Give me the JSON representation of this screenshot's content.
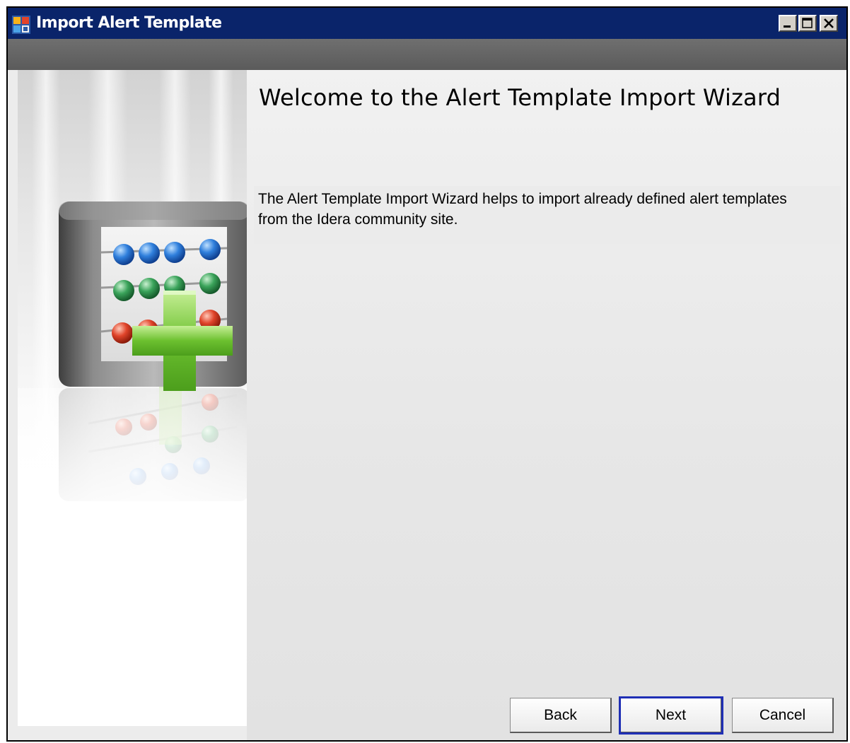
{
  "window": {
    "title": "Import Alert Template"
  },
  "wizard": {
    "heading": "Welcome to the Alert Template Import Wizard",
    "description": "The Alert Template Import Wizard helps to import already defined alert templates from the Idera community site."
  },
  "buttons": {
    "back": "Back",
    "next": "Next",
    "cancel": "Cancel"
  },
  "icons": {
    "app": "app-icon",
    "minimize": "minimize-icon",
    "maximize": "maximize-icon",
    "close": "close-icon",
    "illustration": "abacus-plus-icon"
  },
  "colors": {
    "titlebar": "#0a246a",
    "focus": "#1f2fb5",
    "plus": "#6cc02f"
  }
}
